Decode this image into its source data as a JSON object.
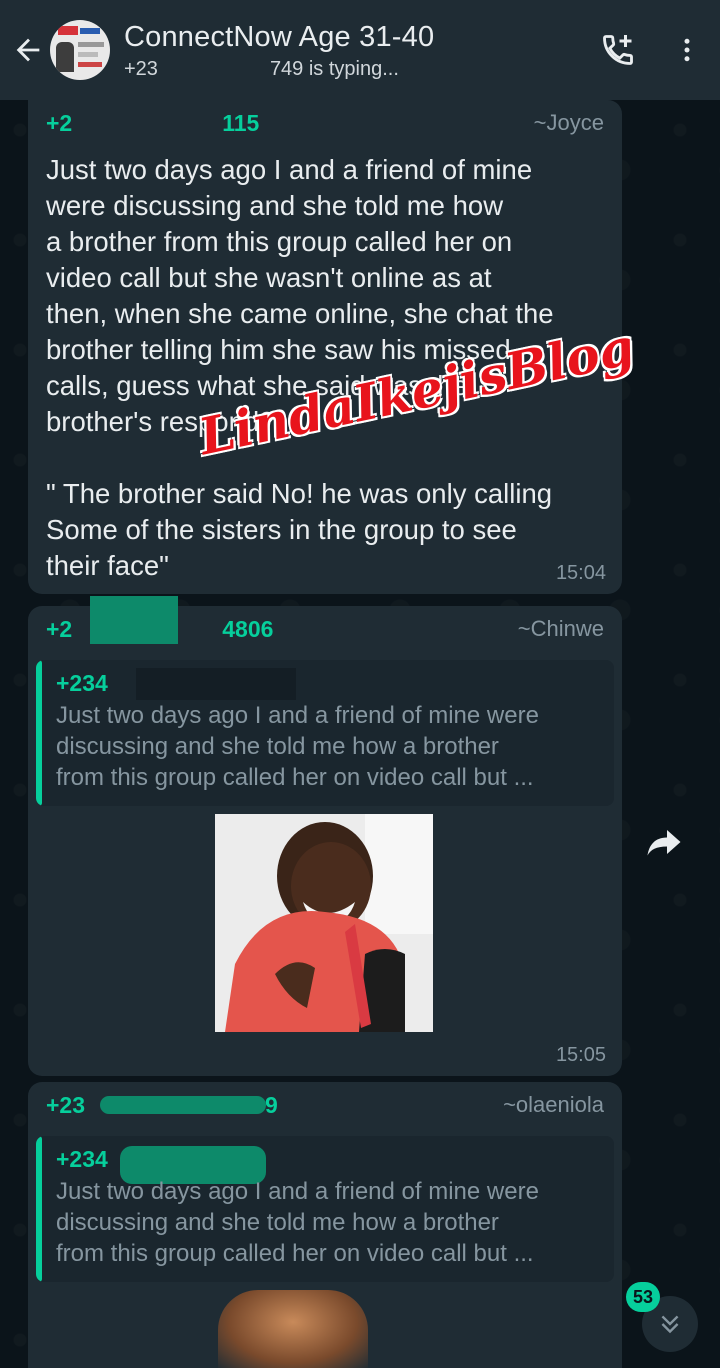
{
  "header": {
    "title": "ConnectNow Age 31-40",
    "subtitle_number": "+23",
    "typing": "749 is typing..."
  },
  "messages": [
    {
      "sender": "+2",
      "sender_suffix": "115",
      "alias": "~Joyce",
      "text": "Just two days ago I and a friend of mine\nwere discussing and she told me how\na brother from this group called her on\nvideo call but she wasn't online as at\nthen, when she came online, she chat  the\nbrother telling him she saw his missed\ncalls, guess what she said was the\nbrother's respond?\n\n\" The brother said No! he was only calling\nSome of the sisters in the group to see\ntheir face\"",
      "time": "15:04"
    },
    {
      "sender": "+2",
      "sender_suffix": "4806",
      "alias": "~Chinwe",
      "quote_sender": "+234",
      "quote_text": "Just two days ago I and a friend of mine were\ndiscussing and she told me how a brother\nfrom this group called her on video call but ...",
      "time": "15:05"
    },
    {
      "sender": "+23",
      "sender_suffix": "9",
      "alias": "~olaeniola",
      "quote_sender": "+234",
      "quote_text": "Just two days ago I and a friend of mine were\ndiscussing and she told me how a brother\nfrom this group called her on video call but ..."
    }
  ],
  "watermark": "LindaIkejisBlog",
  "unread_count": "53",
  "colors": {
    "header_bg": "#1f2c34",
    "chat_bg": "#0b141a",
    "bubble_bg": "#1f2c34",
    "accent": "#06cf9c",
    "watermark": "#e8141c"
  },
  "icons": {
    "back": "arrow-back-icon",
    "add_call": "add-call-icon",
    "menu": "more-vert-icon",
    "forward": "forward-icon",
    "scroll_down": "double-chevron-down-icon"
  }
}
